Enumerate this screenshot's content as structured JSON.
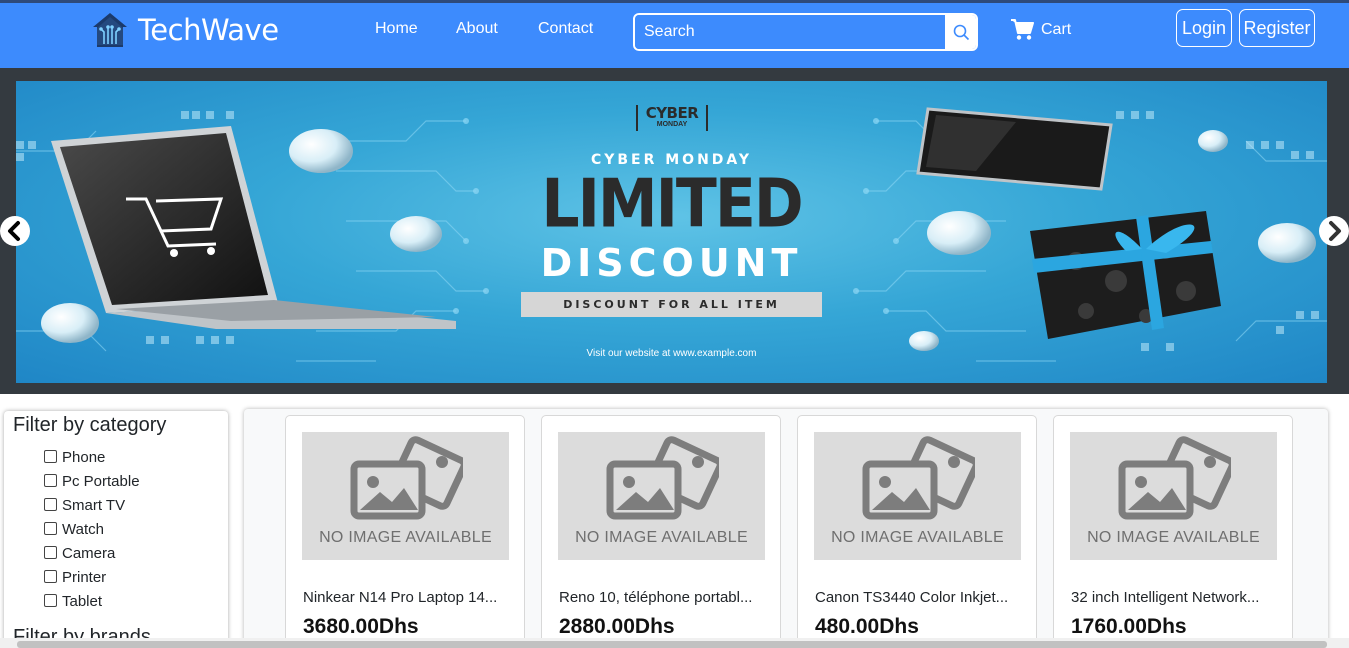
{
  "brand": {
    "name": "TechWave",
    "logo_icon": "circuit-house-icon"
  },
  "nav": {
    "links": [
      "Home",
      "About",
      "Contact"
    ]
  },
  "search": {
    "placeholder": "Search",
    "icon": "search-icon"
  },
  "cart": {
    "label": "Cart",
    "icon": "cart-icon"
  },
  "auth": {
    "login": "Login",
    "register": "Register"
  },
  "banner": {
    "badge_top": "CYBER",
    "badge_bottom": "MONDAY",
    "subtitle": "CYBER MONDAY",
    "headline": "LIMITED",
    "headline2": "DISCOUNT",
    "pill": "DISCOUNT FOR ALL ITEM",
    "website": "Visit our website at www.example.com"
  },
  "filters": {
    "category_title": "Filter by category",
    "categories": [
      "Phone",
      "Pc Portable",
      "Smart TV",
      "Watch",
      "Camera",
      "Printer",
      "Tablet"
    ],
    "brands_title": "Filter by brands"
  },
  "products": [
    {
      "no_image": "NO IMAGE AVAILABLE",
      "title": "Ninkear N14 Pro Laptop 14...",
      "price": "3680.00Dhs"
    },
    {
      "no_image": "NO IMAGE AVAILABLE",
      "title": "Reno 10, téléphone portabl...",
      "price": "2880.00Dhs"
    },
    {
      "no_image": "NO IMAGE AVAILABLE",
      "title": "Canon TS3440 Color Inkjet...",
      "price": "480.00Dhs"
    },
    {
      "no_image": "NO IMAGE AVAILABLE",
      "title": "32 inch Intelligent Network...",
      "price": "1760.00Dhs"
    }
  ],
  "colors": {
    "navbar": "#3d8bfd",
    "banner": "#35a6d6",
    "dark": "#343a40"
  }
}
